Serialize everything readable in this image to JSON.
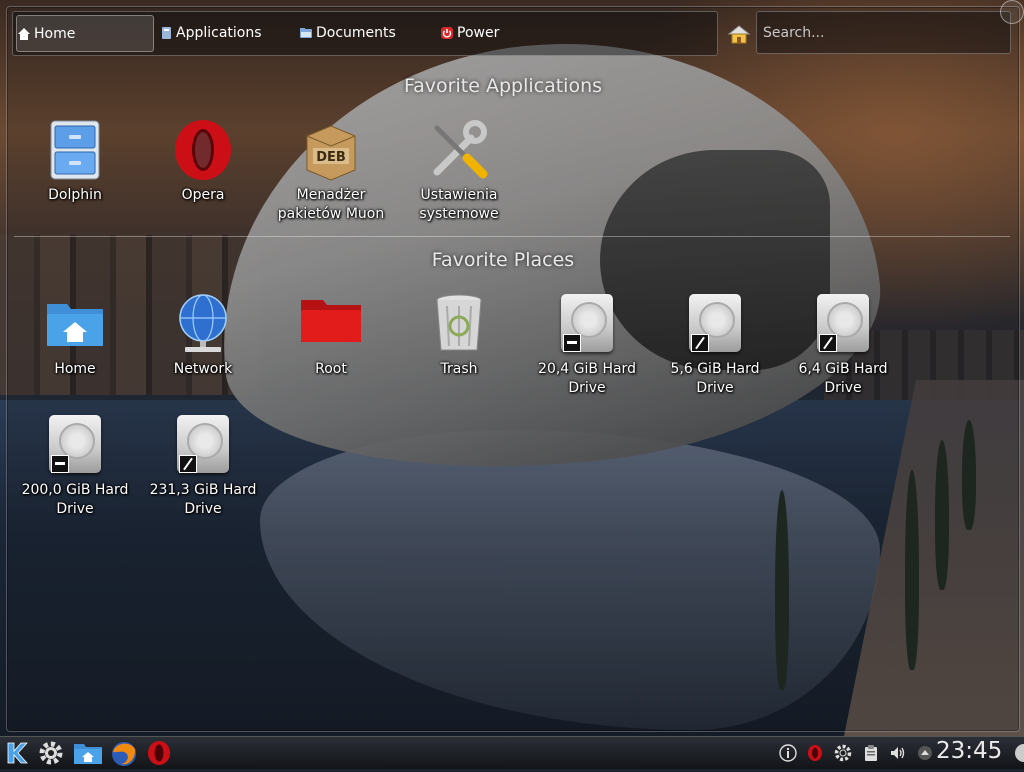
{
  "tabs": [
    {
      "label": "Home"
    },
    {
      "label": "Applications"
    },
    {
      "label": "Documents"
    },
    {
      "label": "Power"
    }
  ],
  "search": {
    "placeholder": "Search..."
  },
  "favorite_applications": {
    "title": "Favorite Applications",
    "items": [
      {
        "label": "Dolphin",
        "icon": "file-cabinet-icon"
      },
      {
        "label": "Opera",
        "icon": "opera-icon"
      },
      {
        "label": "Menadżer pakietów Muon",
        "icon": "deb-package-icon"
      },
      {
        "label": "Ustawienia systemowe",
        "icon": "tools-icon"
      }
    ]
  },
  "favorite_places": {
    "title": "Favorite Places",
    "items": [
      {
        "label": "Home",
        "icon": "home-folder-icon"
      },
      {
        "label": "Network",
        "icon": "network-globe-icon"
      },
      {
        "label": "Root",
        "icon": "red-folder-icon"
      },
      {
        "label": "Trash",
        "icon": "trash-icon"
      },
      {
        "label": "20,4 GiB Hard Drive",
        "icon": "hard-drive-icon"
      },
      {
        "label": "5,6 GiB Hard Drive",
        "icon": "hard-drive-icon"
      },
      {
        "label": "6,4 GiB Hard Drive",
        "icon": "hard-drive-icon"
      },
      {
        "label": "200,0 GiB Hard Drive",
        "icon": "hard-drive-icon"
      },
      {
        "label": "231,3 GiB Hard Drive",
        "icon": "hard-drive-icon"
      }
    ]
  },
  "taskbar": {
    "clock": "23:45"
  },
  "colors": {
    "opera_red": "#cc0f16",
    "folder_blue": "#4aa3e8",
    "root_red": "#e21b1b"
  }
}
